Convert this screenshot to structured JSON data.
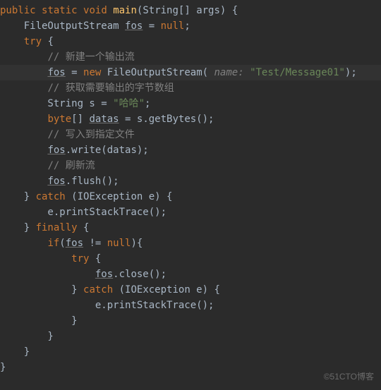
{
  "code": {
    "l1_kw1": "public",
    "l1_kw2": "static",
    "l1_kw3": "void",
    "l1_fn": "main",
    "l1_p1": "(String[] args) {",
    "l2_p1": "    FileOutputStream ",
    "l2_var": "fos",
    "l2_p2": " = ",
    "l2_kw": "null",
    "l2_p3": ";",
    "l3_p1": "    ",
    "l3_kw": "try",
    "l3_p2": " {",
    "l4_p1": "        ",
    "l4_cmt": "// 新建一个输出流",
    "l5_p1": "        ",
    "l5_var": "fos",
    "l5_p2": " = ",
    "l5_kw": "new",
    "l5_p3": " FileOutputStream( ",
    "l5_param": "name: ",
    "l5_str": "\"Test/Message01\"",
    "l5_p4": ");",
    "l6_p1": "        ",
    "l6_cmt": "// 获取需要输出的字节数组",
    "l7_p1": "        String s = ",
    "l7_str": "\"哈哈\"",
    "l7_p2": ";",
    "l8_p1": "        ",
    "l8_kw": "byte",
    "l8_p2": "[] ",
    "l8_var": "datas",
    "l8_p3": " = s.getBytes();",
    "l9_p1": "        ",
    "l9_cmt": "// 写入到指定文件",
    "l10_p1": "        ",
    "l10_var": "fos",
    "l10_p2": ".write(datas);",
    "l11_p1": "        ",
    "l11_cmt": "// 刷新流",
    "l12_p1": "        ",
    "l12_var": "fos",
    "l12_p2": ".flush();",
    "l13_p1": "    } ",
    "l13_kw": "catch",
    "l13_p2": " (IOException e) {",
    "l14_p1": "        e.printStackTrace();",
    "l15_p1": "    } ",
    "l15_kw": "finally",
    "l15_p2": " {",
    "l16_p1": "        ",
    "l16_kw": "if",
    "l16_p2": "(",
    "l16_var": "fos",
    "l16_p3": " != ",
    "l16_kw2": "null",
    "l16_p4": "){",
    "l17_p1": "            ",
    "l17_kw": "try",
    "l17_p2": " {",
    "l18_p1": "                ",
    "l18_var": "fos",
    "l18_p2": ".close();",
    "l19_p1": "            } ",
    "l19_kw": "catch",
    "l19_p2": " (IOException e) {",
    "l20_p1": "                e.printStackTrace();",
    "l21_p1": "            }",
    "l22_p1": "        }",
    "l23_p1": "    }",
    "l24_p1": "}"
  },
  "watermark": "©51CTO博客"
}
